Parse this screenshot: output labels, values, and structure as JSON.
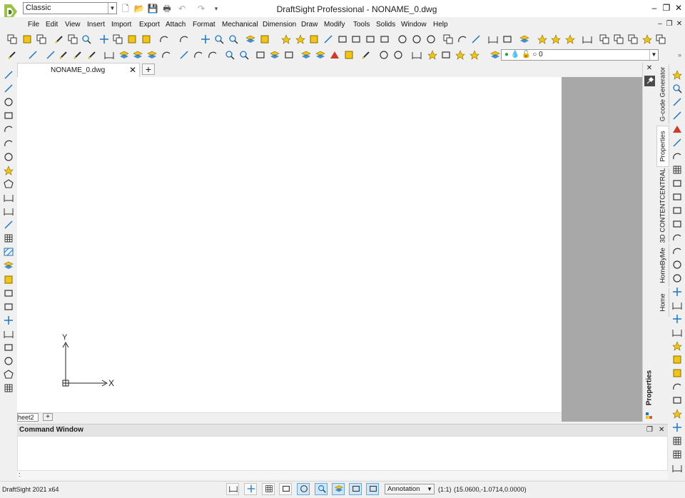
{
  "colors": {
    "accent": "#1b76c5",
    "canvas": "#ffffff",
    "paper_gray": "#a8a8a8",
    "toolbar_bg": "#f0f0f0",
    "icon_yellow": "#f0c419",
    "icon_blue": "#1b76c5"
  },
  "titlebar": {
    "workspace": "Classic",
    "title": "DraftSight Professional - NONAME_0.dwg"
  },
  "menu": {
    "items": [
      "File",
      "Edit",
      "View",
      "Insert",
      "Import",
      "Export",
      "Attach",
      "Format",
      "Mechanical",
      "Dimension",
      "Draw",
      "Modify",
      "Tools",
      "Solids",
      "Window",
      "Help"
    ]
  },
  "layer": {
    "name": "0"
  },
  "document": {
    "tab_label": "NONAME_0.dwg"
  },
  "sheet": {
    "tab_label": "heet2",
    "add_label": "+"
  },
  "axis": {
    "x_label": "X",
    "y_label": "Y"
  },
  "panels": {
    "properties_label": "Properties",
    "vertical_tabs": [
      "G-code Generator",
      "Properties",
      "3D CONTENTCENTRAL",
      "HomeByMe",
      "Home"
    ]
  },
  "command": {
    "title": "Command Window",
    "prompt": ":"
  },
  "status": {
    "app": "DraftSight 2021 x64",
    "annotation": "Annotation",
    "scale": "(1:1)",
    "coords": "(15.0600,-1.0714,0.0000)"
  }
}
